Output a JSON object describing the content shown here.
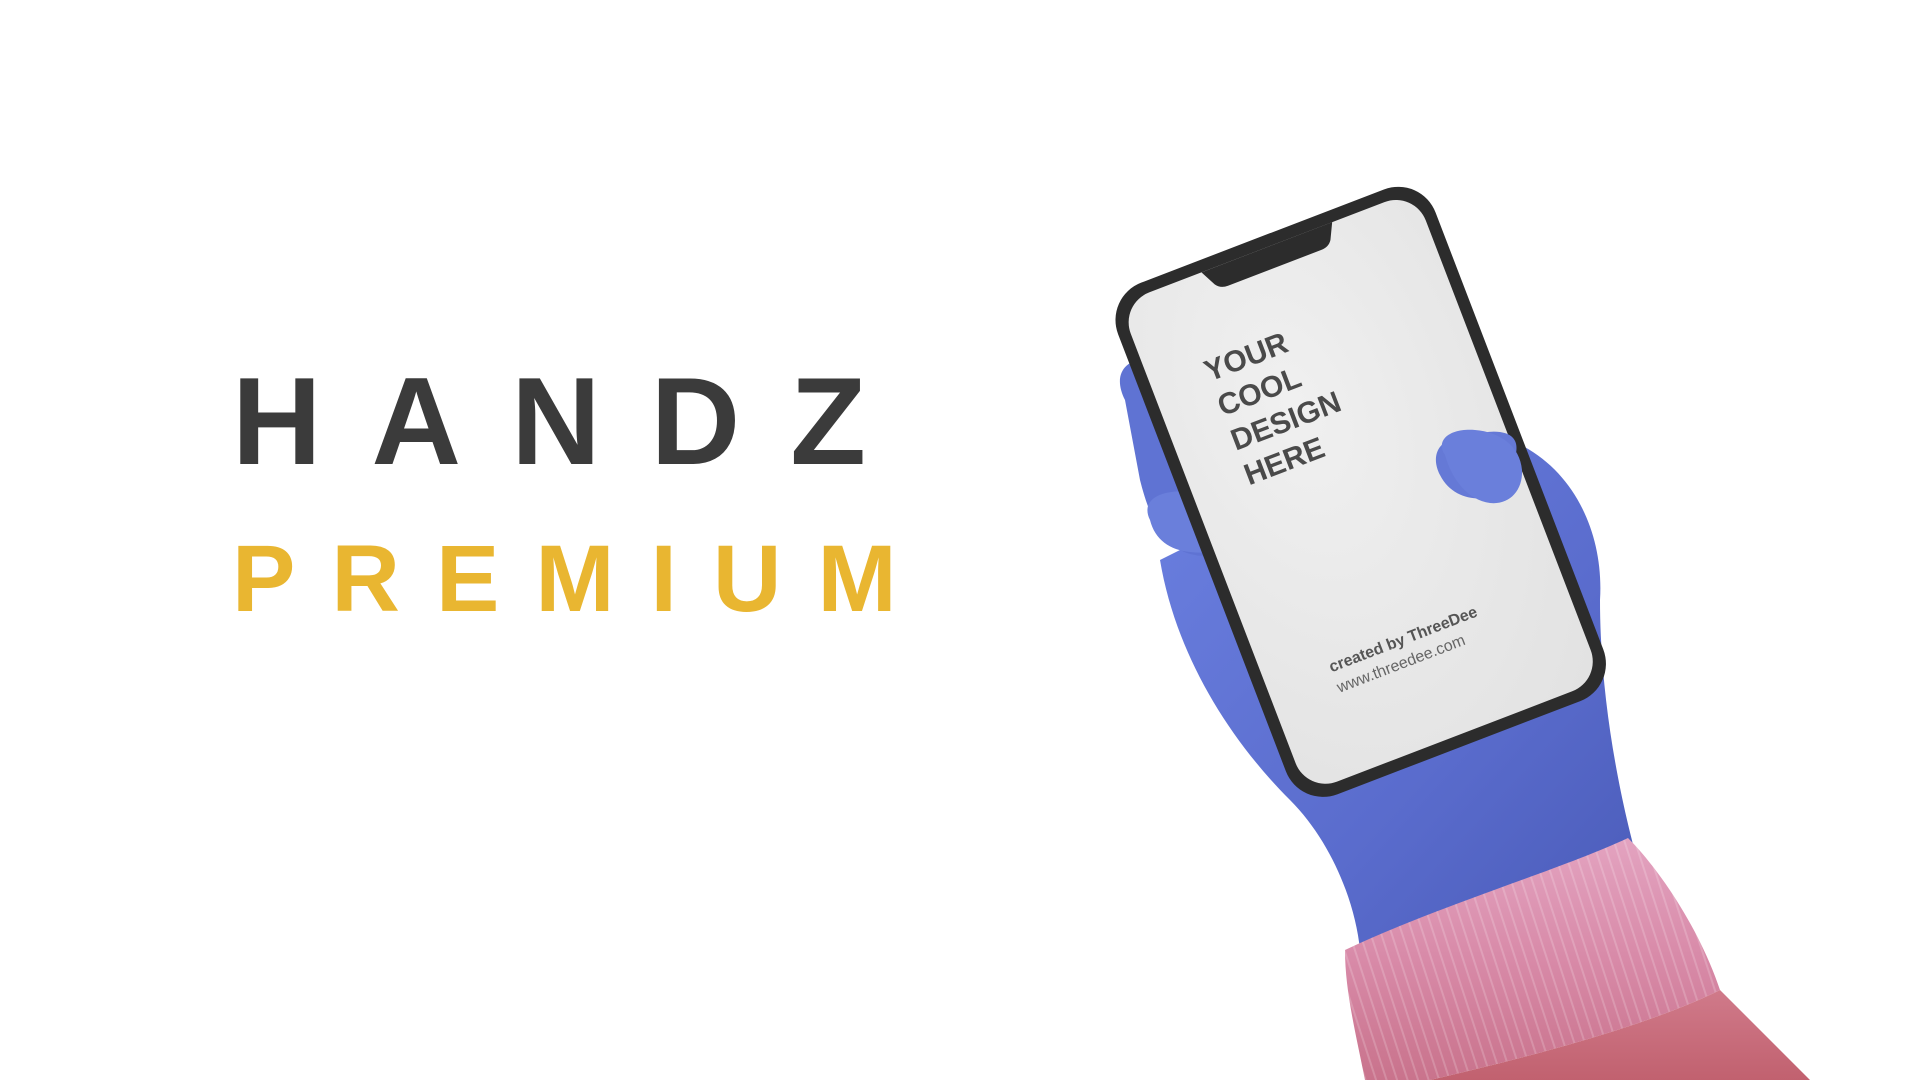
{
  "brand": {
    "title": "HANDZ",
    "subtitle": "PREMIUM"
  },
  "phone_screen": {
    "headline_lines": [
      "YOUR",
      "COOL",
      "DESIGN",
      "HERE"
    ],
    "credit_line": "created by ThreeDee",
    "url_line": "www.threedee.com"
  },
  "colors": {
    "title": "#3b3b3b",
    "accent": "#e9b631",
    "glove": "#5b6fd0",
    "sleeve": "#d98aa8",
    "phone_frame": "#2c2c2c",
    "phone_screen": "#e8e8e8"
  }
}
